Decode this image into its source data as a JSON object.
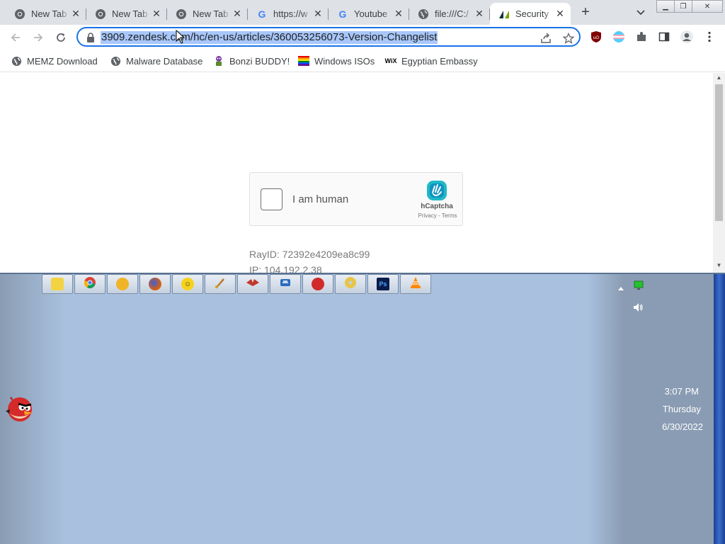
{
  "tabs": [
    {
      "title": "New Tab",
      "icon": "chrome-icon"
    },
    {
      "title": "New Tab",
      "icon": "chrome-icon"
    },
    {
      "title": "New Tab",
      "icon": "chrome-icon"
    },
    {
      "title": "https://w",
      "icon": "google-icon"
    },
    {
      "title": "Youtube",
      "icon": "google-icon"
    },
    {
      "title": "file:///C:/",
      "icon": "globe-icon"
    },
    {
      "title": "Security",
      "icon": "zendesk-icon",
      "active": true
    }
  ],
  "address_bar": {
    "url": "3909.zendesk.com/hc/en-us/articles/360053256073-Version-Changelist"
  },
  "bookmarks": [
    {
      "label": "MEMZ Download",
      "icon": "globe-icon"
    },
    {
      "label": "Malware Database",
      "icon": "globe-icon"
    },
    {
      "label": "Bonzi BUDDY!",
      "icon": "bonzi-icon"
    },
    {
      "label": "Windows ISOs",
      "icon": "rainbow-flag-icon"
    },
    {
      "label": "Egyptian Embassy",
      "icon": "wix-icon"
    }
  ],
  "wix_icon_text": "WiX",
  "captcha": {
    "label": "I am human",
    "brand": "hCaptcha",
    "links": "Privacy - Terms"
  },
  "ray_id": "RayID: 72392e4209ea8c99",
  "ip": "IP: 104.192.2.38",
  "taskbar": {
    "quick_launch": [
      "desktop-icon",
      "chrome-icon",
      "sun-icon",
      "firefox-icon",
      "smiley-icon",
      "paint-icon",
      "bird-icon",
      "ie-icon",
      "angry-bird-icon",
      "disc-icon",
      "photoshop-icon",
      "vlc-icon"
    ],
    "photoshop_text": "Ps"
  },
  "clock": {
    "time": "3:07 PM",
    "day": "Thursday",
    "date": "6/30/2022"
  },
  "colors": {
    "accent": "#1a73e8",
    "url_highlight": "#a8c7fa",
    "desktop": "#a9c1de"
  }
}
